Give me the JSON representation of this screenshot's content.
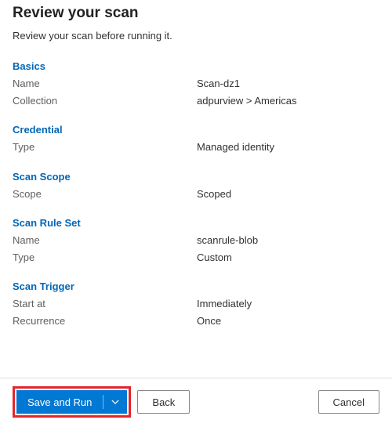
{
  "title": "Review your scan",
  "subtitle": "Review your scan before running it.",
  "sections": {
    "basics": {
      "header": "Basics",
      "name_label": "Name",
      "name_value": "Scan-dz1",
      "collection_label": "Collection",
      "collection_value": "adpurview > Americas"
    },
    "credential": {
      "header": "Credential",
      "type_label": "Type",
      "type_value": "Managed identity"
    },
    "scope": {
      "header": "Scan Scope",
      "scope_label": "Scope",
      "scope_value": "Scoped"
    },
    "ruleset": {
      "header": "Scan Rule Set",
      "name_label": "Name",
      "name_value": "scanrule-blob",
      "type_label": "Type",
      "type_value": "Custom"
    },
    "trigger": {
      "header": "Scan Trigger",
      "start_label": "Start at",
      "start_value": "Immediately",
      "recurrence_label": "Recurrence",
      "recurrence_value": "Once"
    }
  },
  "footer": {
    "save_run": "Save and Run",
    "back": "Back",
    "cancel": "Cancel"
  },
  "colors": {
    "link": "#0066b8",
    "primary": "#0078d4",
    "highlight": "#e3262b"
  }
}
